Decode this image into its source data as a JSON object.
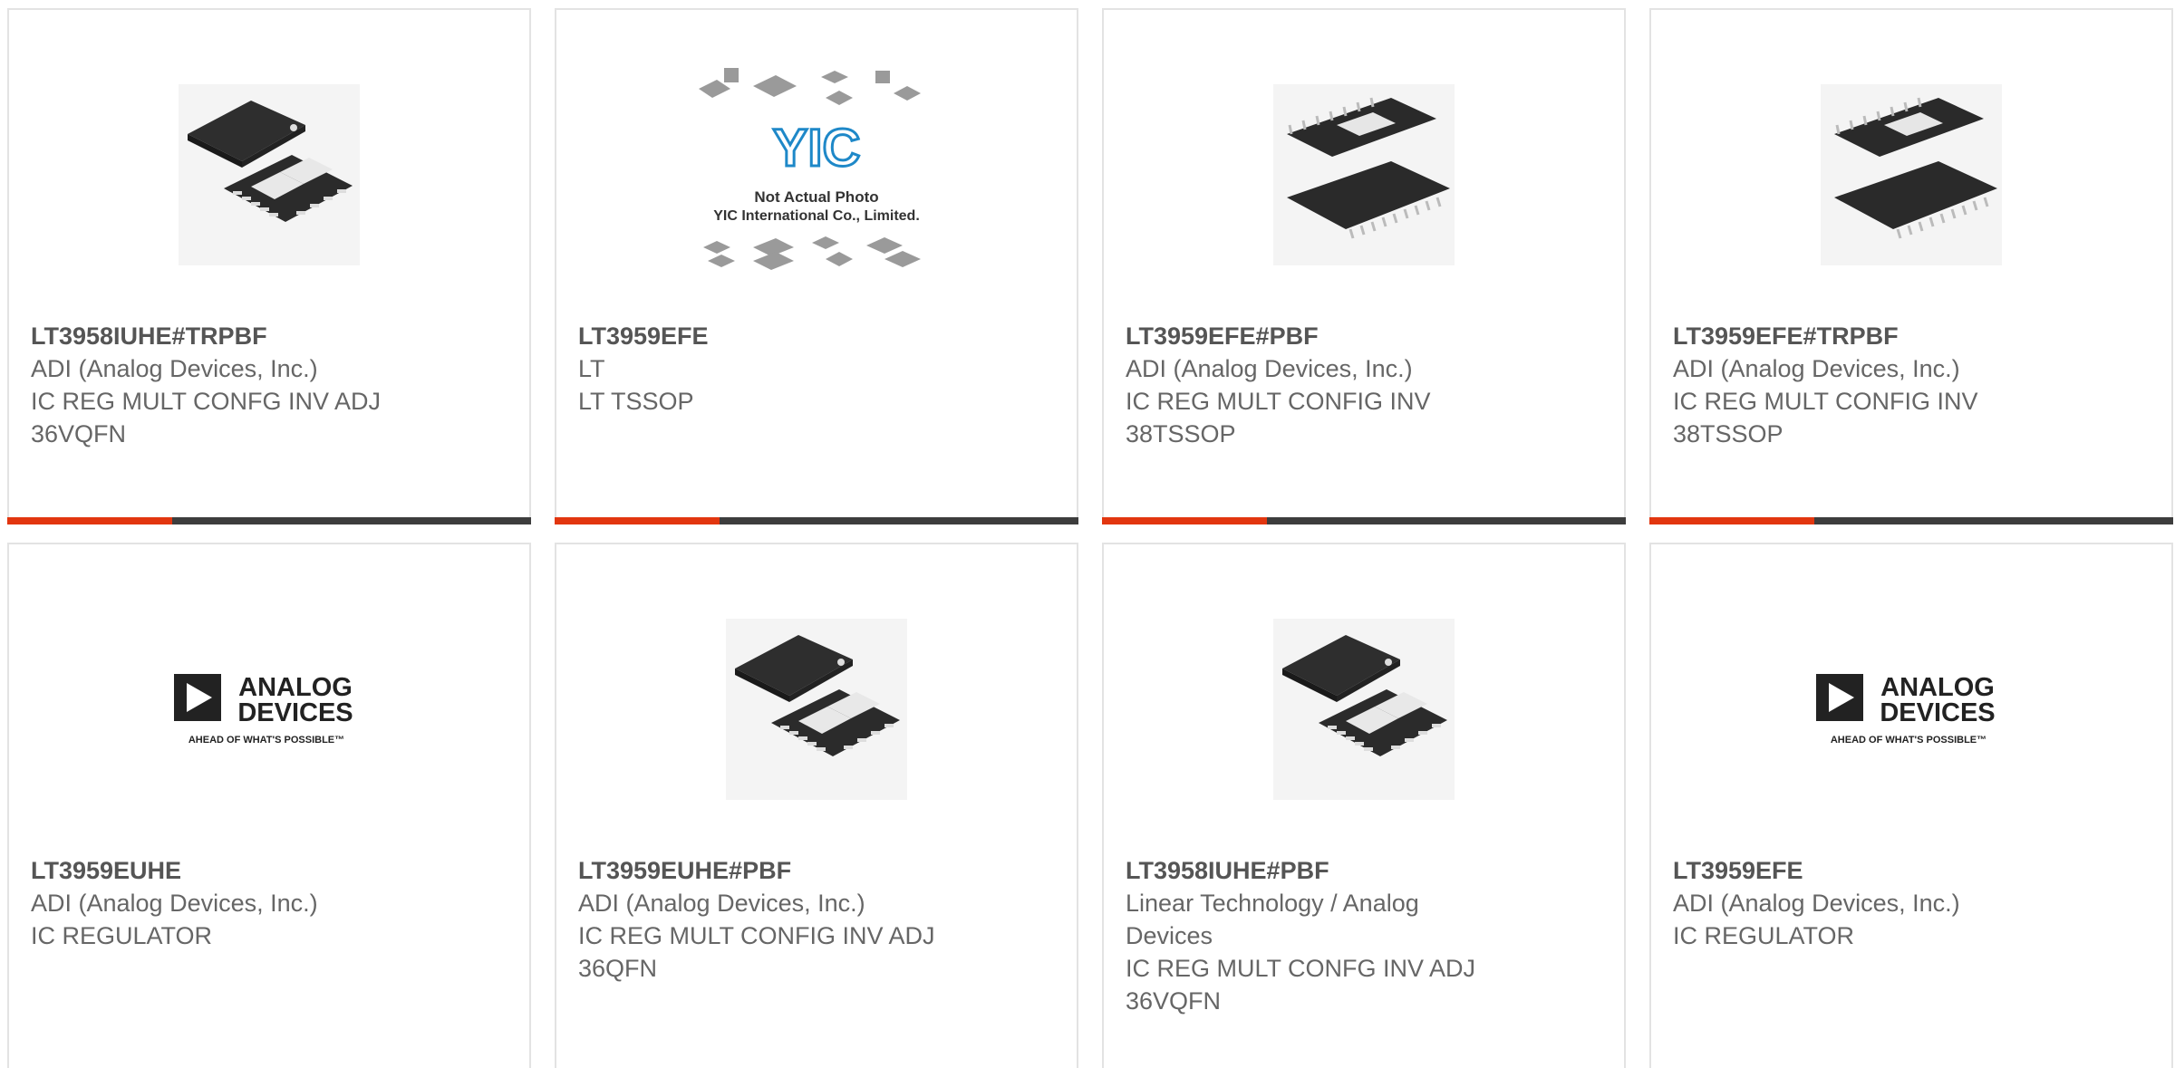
{
  "colors": {
    "accent": "#e2360f",
    "bar_dark": "#3d3d3d",
    "border": "#e3e3e3",
    "text": "#666666"
  },
  "cards": [
    {
      "part": "LT3958IUHE#TRPBF",
      "manufacturer": "ADI (Analog Devices, Inc.)",
      "description": "IC REG MULT CONFG INV ADJ\n36VQFN",
      "image": "qfn-chip"
    },
    {
      "part": "LT3959EFE",
      "manufacturer": "LT",
      "description": "LT TSSOP",
      "image": "yic-not-actual-photo",
      "yic": {
        "logo": "YIC",
        "line1": "Not Actual Photo",
        "line2": "YIC International Co., Limited."
      }
    },
    {
      "part": "LT3959EFE#PBF",
      "manufacturer": "ADI (Analog Devices, Inc.)",
      "description": "IC REG MULT CONFIG INV\n38TSSOP",
      "image": "tssop-chip"
    },
    {
      "part": "LT3959EFE#TRPBF",
      "manufacturer": "ADI (Analog Devices, Inc.)",
      "description": "IC REG MULT CONFIG INV\n38TSSOP",
      "image": "tssop-chip"
    },
    {
      "part": "LT3959EUHE",
      "manufacturer": "ADI (Analog Devices, Inc.)",
      "description": "IC REGULATOR",
      "image": "analog-devices-logo",
      "logo": {
        "line1": "ANALOG",
        "line2": "DEVICES",
        "tagline": "AHEAD OF WHAT'S POSSIBLE™"
      }
    },
    {
      "part": "LT3959EUHE#PBF",
      "manufacturer": "ADI (Analog Devices, Inc.)",
      "description": "IC REG MULT CONFIG INV ADJ\n36QFN",
      "image": "qfn-chip"
    },
    {
      "part": "LT3958IUHE#PBF",
      "manufacturer": "Linear Technology / Analog\nDevices",
      "description": "IC REG MULT CONFG INV ADJ\n36VQFN",
      "image": "qfn-chip"
    },
    {
      "part": "LT3959EFE",
      "manufacturer": "ADI (Analog Devices, Inc.)",
      "description": "IC REGULATOR",
      "image": "analog-devices-logo",
      "logo": {
        "line1": "ANALOG",
        "line2": "DEVICES",
        "tagline": "AHEAD OF WHAT'S POSSIBLE™"
      }
    }
  ]
}
